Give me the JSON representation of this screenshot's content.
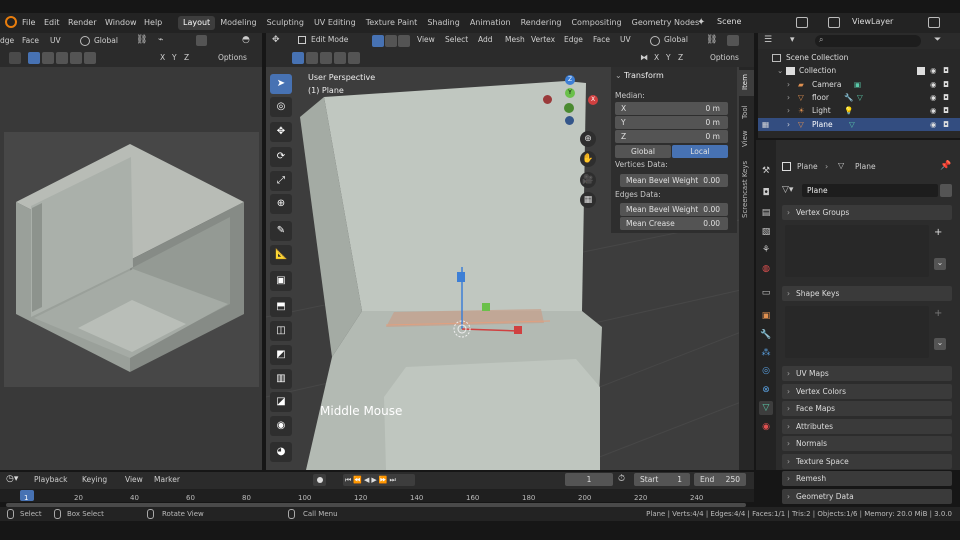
{
  "menu": [
    "File",
    "Edit",
    "Render",
    "Window",
    "Help"
  ],
  "workspaces": [
    "Layout",
    "Modeling",
    "Sculpting",
    "UV Editing",
    "Texture Paint",
    "Shading",
    "Animation",
    "Rendering",
    "Compositing",
    "Geometry Nodes"
  ],
  "active_workspace": "Layout",
  "scene": "Scene",
  "view_layer": "ViewLayer",
  "left_header": {
    "items": [
      "dge",
      "Face",
      "UV"
    ],
    "orientation": "Global",
    "options": "Options"
  },
  "viewport_header": {
    "mode": "Edit Mode",
    "menus": [
      "View",
      "Select",
      "Add",
      "Mesh",
      "Vertex",
      "Edge",
      "Face",
      "UV"
    ],
    "orientation": "Global",
    "options": "Options",
    "axes": [
      "X",
      "Y",
      "Z"
    ]
  },
  "viewport": {
    "perspective": "User Perspective",
    "object": "(1) Plane",
    "overlay_text": "Middle Mouse",
    "gizmo": {
      "x": "X",
      "y": "Y",
      "z": "Z"
    }
  },
  "n_panel": {
    "title": "Transform",
    "median_label": "Median:",
    "fields": [
      {
        "label": "X",
        "value": "0 m"
      },
      {
        "label": "Y",
        "value": "0 m"
      },
      {
        "label": "Z",
        "value": "0 m"
      }
    ],
    "global": "Global",
    "local": "Local",
    "vertices_data": "Vertices Data:",
    "vertex_bevel": {
      "label": "Mean Bevel Weight",
      "value": "0.00"
    },
    "edges_data": "Edges Data:",
    "edge_bevel": {
      "label": "Mean Bevel Weight",
      "value": "0.00"
    },
    "edge_crease": {
      "label": "Mean Crease",
      "value": "0.00"
    },
    "tabs": [
      "Item",
      "Tool",
      "View",
      "Screencast Keys"
    ]
  },
  "outliner": {
    "root": "Scene Collection",
    "collection": "Collection",
    "items": [
      "Camera",
      "floor",
      "Light",
      "Plane"
    ],
    "selected": "Plane"
  },
  "properties": {
    "breadcrumb_object": "Plane",
    "breadcrumb_mesh": "Plane",
    "mesh_name": "Plane",
    "vertex_groups": "Vertex Groups",
    "shape_keys": "Shape Keys",
    "sections": [
      "UV Maps",
      "Vertex Colors",
      "Face Maps",
      "Attributes",
      "Normals",
      "Texture Space",
      "Remesh",
      "Geometry Data"
    ]
  },
  "timeline": {
    "menus": [
      "Playback",
      "Keying",
      "View",
      "Marker"
    ],
    "current_frame": "1",
    "start_label": "Start",
    "start": "1",
    "end_label": "End",
    "end": "250",
    "ticks": [
      "1",
      "20",
      "40",
      "60",
      "80",
      "100",
      "120",
      "140",
      "160",
      "180",
      "200",
      "220",
      "240"
    ]
  },
  "status": {
    "select": "Select",
    "box_select": "Box Select",
    "rotate_view": "Rotate View",
    "call_menu": "Call Menu",
    "stats": "Plane | Verts:4/4 | Edges:4/4 | Faces:1/1 | Tris:2 | Objects:1/6 | Memory: 20.0 MiB | 3.0.0"
  },
  "colors": {
    "accent": "#4772b3",
    "header": "#2b2b2b",
    "panel": "#303030",
    "viewport": "#3d3d3d"
  }
}
